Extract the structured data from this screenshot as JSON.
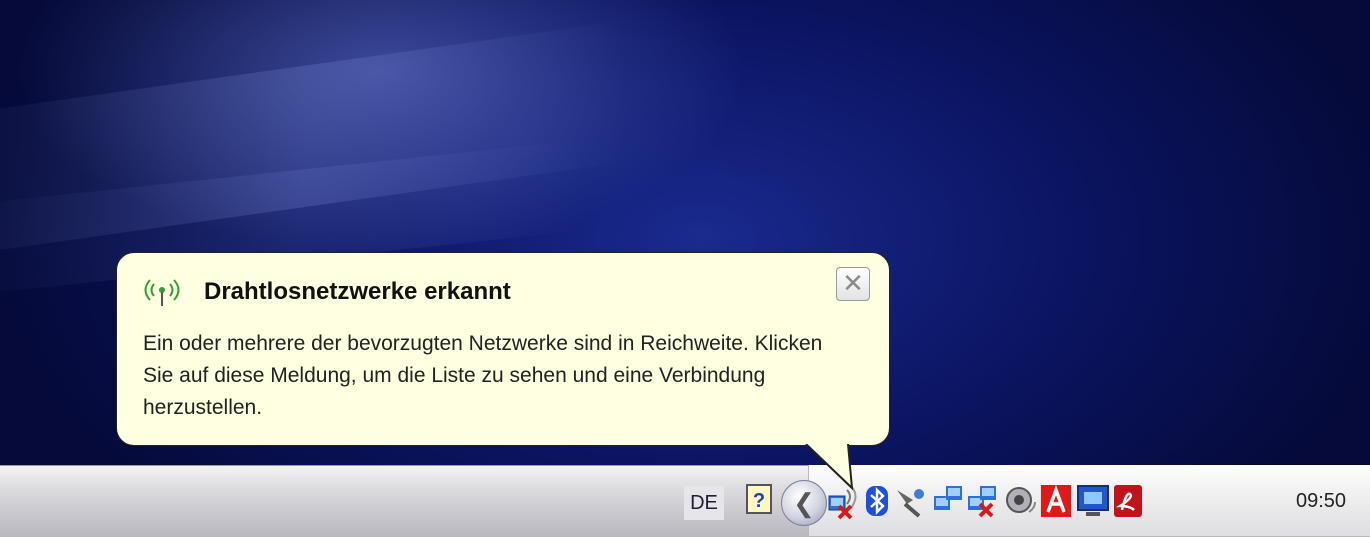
{
  "balloon": {
    "title": "Drahtlosnetzwerke erkannt",
    "message": "Ein oder mehrere der bevorzugten Netzwerke sind in Reichweite. Klicken Sie auf diese Meldung, um die Liste zu sehen und eine Verbindung herzustellen.",
    "close_glyph": "✕",
    "icon": "wireless-antenna-icon"
  },
  "taskbar": {
    "language": "DE",
    "help_glyph": "?",
    "expand_glyph": "❮",
    "clock": "09:50"
  },
  "tray_icons": [
    "network-disconnected-icon",
    "bluetooth-icon",
    "satellite-icon",
    "network-connected-icon",
    "network-disconnected-icon",
    "volume-icon",
    "antivirus-icon",
    "display-icon",
    "acrobat-icon"
  ],
  "colors": {
    "balloon_bg": "#ffffe1",
    "desktop_bg": "#0a1460",
    "taskbar_bg": "#d0d0d6"
  }
}
